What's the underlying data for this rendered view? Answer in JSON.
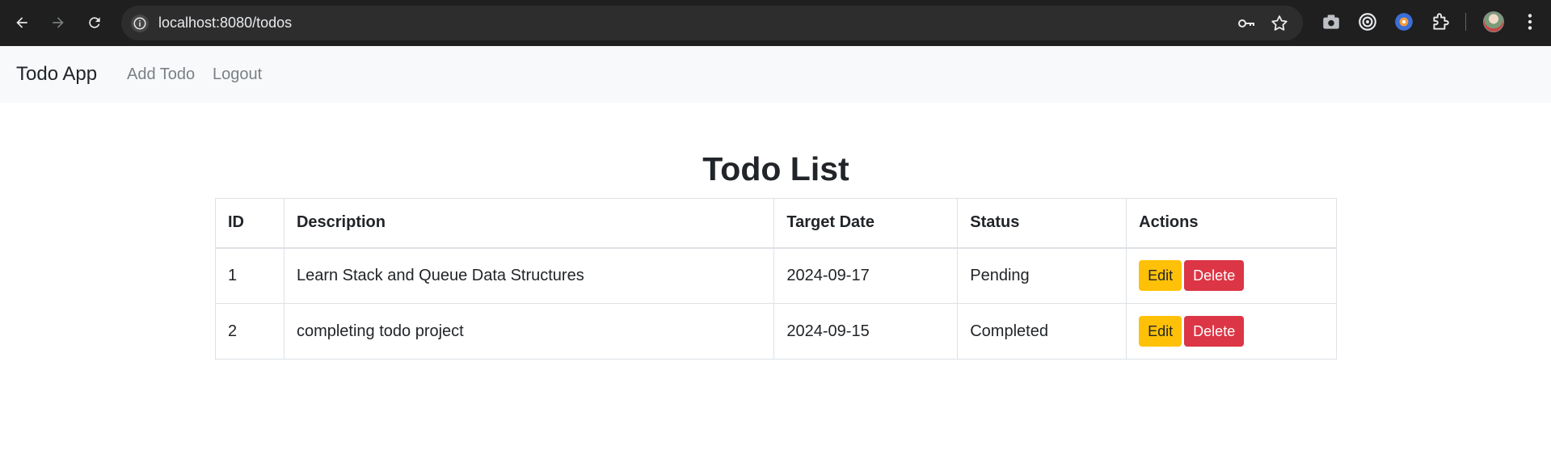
{
  "browser": {
    "url": "localhost:8080/todos",
    "icons": {
      "back": "arrow-left-icon",
      "forward": "arrow-right-icon",
      "reload": "reload-icon",
      "site_info": "info-icon",
      "password": "key-icon",
      "bookmark": "star-icon",
      "screenshot": "camera-icon",
      "extension_target": "target-icon",
      "extension_blue": "extension-badge-icon",
      "extensions": "puzzle-icon",
      "menu": "kebab-menu-icon"
    }
  },
  "navbar": {
    "brand": "Todo App",
    "links": [
      "Add Todo",
      "Logout"
    ]
  },
  "main": {
    "title": "Todo List",
    "columns": [
      "ID",
      "Description",
      "Target Date",
      "Status",
      "Actions"
    ],
    "rows": [
      {
        "id": "1",
        "description": "Learn Stack and Queue Data Structures",
        "target_date": "2024-09-17",
        "status": "Pending"
      },
      {
        "id": "2",
        "description": "completing todo project",
        "target_date": "2024-09-15",
        "status": "Completed"
      }
    ],
    "edit_label": "Edit",
    "delete_label": "Delete"
  },
  "colors": {
    "edit_button": "#ffc107",
    "delete_button": "#dc3545",
    "navbar_bg": "#f8f9fa"
  }
}
